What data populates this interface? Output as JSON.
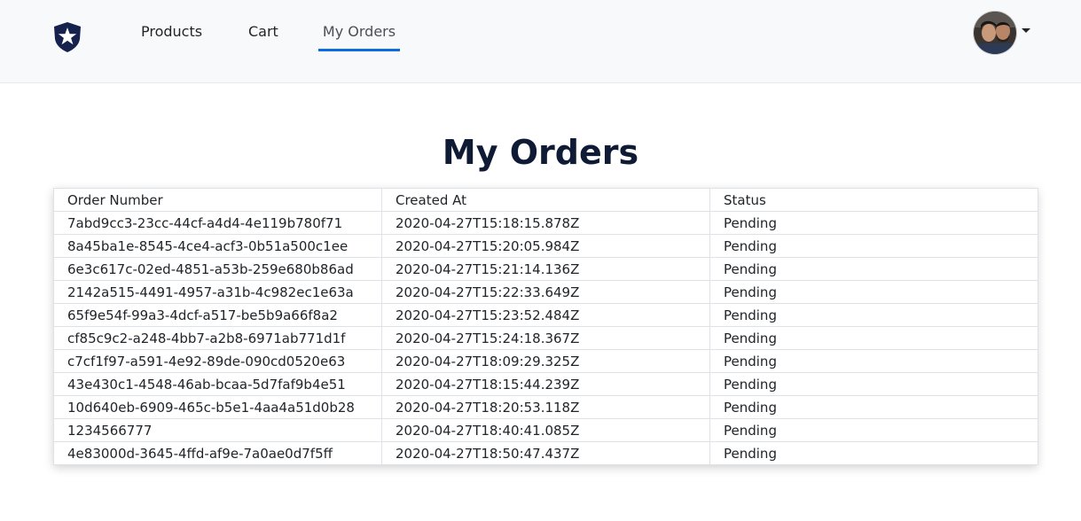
{
  "navbar": {
    "logo_icon": "shield-star-icon",
    "links": [
      {
        "label": "Products"
      },
      {
        "label": "Cart"
      },
      {
        "label": "My Orders",
        "active": true
      }
    ],
    "accent_color": "#0d6de0",
    "user_avatar_icon": "user-avatar-icon",
    "dropdown_icon": "caret-down-icon"
  },
  "main": {
    "title": "My Orders",
    "table": {
      "headers": [
        "Order Number",
        "Created At",
        "Status"
      ],
      "rows": [
        [
          "7abd9cc3-23cc-44cf-a4d4-4e119b780f71",
          "2020-04-27T15:18:15.878Z",
          "Pending"
        ],
        [
          "8a45ba1e-8545-4ce4-acf3-0b51a500c1ee",
          "2020-04-27T15:20:05.984Z",
          "Pending"
        ],
        [
          "6e3c617c-02ed-4851-a53b-259e680b86ad",
          "2020-04-27T15:21:14.136Z",
          "Pending"
        ],
        [
          "2142a515-4491-4957-a31b-4c982ec1e63a",
          "2020-04-27T15:22:33.649Z",
          "Pending"
        ],
        [
          "65f9e54f-99a3-4dcf-a517-be5b9a66f8a2",
          "2020-04-27T15:23:52.484Z",
          "Pending"
        ],
        [
          "cf85c9c2-a248-4bb7-a2b8-6971ab771d1f",
          "2020-04-27T15:24:18.367Z",
          "Pending"
        ],
        [
          "c7cf1f97-a591-4e92-89de-090cd0520e63",
          "2020-04-27T18:09:29.325Z",
          "Pending"
        ],
        [
          "43e430c1-4548-46ab-bcaa-5d7faf9b4e51",
          "2020-04-27T18:15:44.239Z",
          "Pending"
        ],
        [
          "10d640eb-6909-465c-b5e1-4aa4a51d0b28",
          "2020-04-27T18:20:53.118Z",
          "Pending"
        ],
        [
          "1234566777",
          "2020-04-27T18:40:41.085Z",
          "Pending"
        ],
        [
          "4e83000d-3645-4ffd-af9e-7a0ae0d7f5ff",
          "2020-04-27T18:50:47.437Z",
          "Pending"
        ]
      ]
    }
  }
}
